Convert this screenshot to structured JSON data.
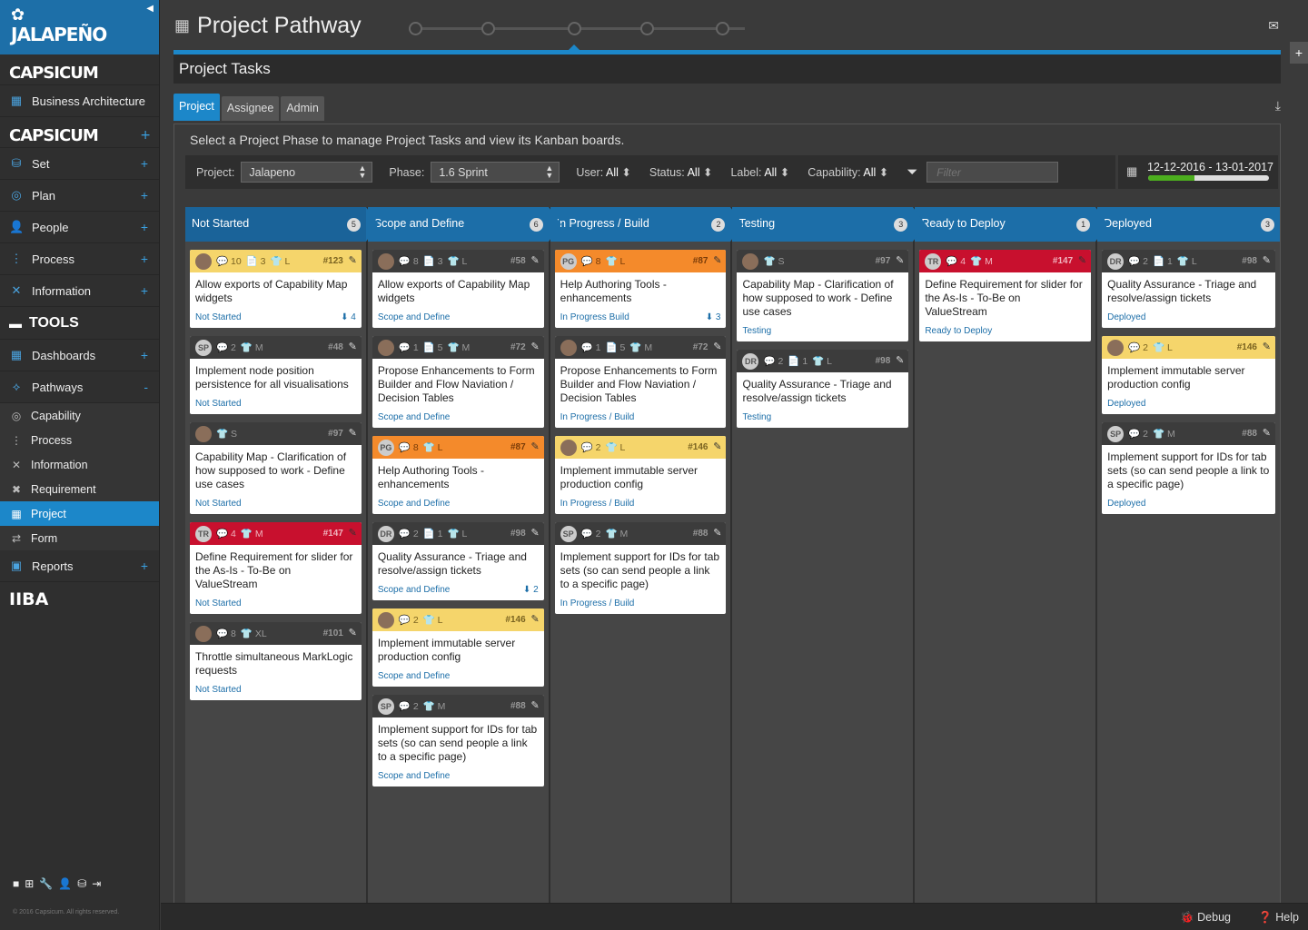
{
  "sidebar": {
    "logo": "JALAPEÑO",
    "brand1": "CAPSICUM",
    "business_architecture": "Business Architecture",
    "brand2": "CAPSICUM",
    "items": [
      {
        "label": "Set",
        "icon": "set-icon"
      },
      {
        "label": "Plan",
        "icon": "target-icon"
      },
      {
        "label": "People",
        "icon": "person-icon"
      },
      {
        "label": "Process",
        "icon": "process-icon"
      },
      {
        "label": "Information",
        "icon": "tools-icon"
      }
    ],
    "tools": "TOOLS",
    "dashboards": "Dashboards",
    "pathways": "Pathways",
    "pathways_toggle": "-",
    "sub_items": [
      {
        "label": "Capability"
      },
      {
        "label": "Process"
      },
      {
        "label": "Information"
      },
      {
        "label": "Requirement"
      },
      {
        "label": "Project"
      },
      {
        "label": "Form"
      }
    ],
    "reports": "Reports",
    "iiba": "IIBA",
    "copyright": "© 2016 Capsicum. All rights reserved."
  },
  "header": {
    "title": "Project Pathway",
    "subtitle": "Project Tasks"
  },
  "tabs": [
    "Project",
    "Assignee",
    "Admin"
  ],
  "instructions": "Select a Project Phase to manage Project Tasks and view its Kanban boards.",
  "filters": {
    "project_label": "Project:",
    "project_value": "Jalapeno",
    "phase_label": "Phase:",
    "phase_value": "1.6 Sprint",
    "user": {
      "label": "User:",
      "value": "All"
    },
    "status": {
      "label": "Status:",
      "value": "All"
    },
    "label": {
      "label": "Label:",
      "value": "All"
    },
    "capability": {
      "label": "Capability:",
      "value": "All"
    },
    "filter_placeholder": "Filter"
  },
  "date_range": {
    "text": "12-12-2016 - 13-01-2017",
    "progress": 0.38
  },
  "columns": [
    {
      "title": "Not Started",
      "count": "5",
      "cards": [
        {
          "color": "yellow",
          "avatar": "",
          "photo": true,
          "meta": [
            "💬 10",
            "📄 3",
            "👕 L"
          ],
          "num": "#123",
          "title": "Allow exports of Capability Map widgets",
          "status": "Not Started",
          "arrow": "4"
        },
        {
          "color": "dark",
          "avatar": "SP",
          "photo": false,
          "meta": [
            "💬 2",
            "👕 M"
          ],
          "num": "#48",
          "title": "Implement node position persistence for all visualisations",
          "status": "Not Started",
          "arrow": ""
        },
        {
          "color": "dark",
          "avatar": "",
          "photo": true,
          "meta": [
            "👕 S"
          ],
          "num": "#97",
          "title": "Capability Map - Clarification of how supposed to work - Define use cases",
          "status": "Not Started",
          "arrow": ""
        },
        {
          "color": "red",
          "avatar": "TR",
          "photo": false,
          "meta": [
            "💬 4",
            "👕 M"
          ],
          "num": "#147",
          "title": "Define Requirement for slider for the As-Is - To-Be on ValueStream",
          "status": "Not Started",
          "arrow": ""
        },
        {
          "color": "dark",
          "avatar": "",
          "photo": true,
          "meta": [
            "💬 8",
            "👕 XL"
          ],
          "num": "#101",
          "title": "Throttle simultaneous MarkLogic requests",
          "status": "Not Started",
          "arrow": ""
        }
      ]
    },
    {
      "title": "Scope and Define",
      "count": "6",
      "cards": [
        {
          "color": "dark",
          "avatar": "",
          "photo": true,
          "meta": [
            "💬 8",
            "📄 3",
            "👕 L"
          ],
          "num": "#58",
          "title": "Allow exports of Capability Map widgets",
          "status": "Scope and Define",
          "arrow": ""
        },
        {
          "color": "dark",
          "avatar": "",
          "photo": true,
          "meta": [
            "💬 1",
            "📄 5",
            "👕 M"
          ],
          "num": "#72",
          "title": "Propose Enhancements to Form Builder and Flow Naviation / Decision Tables",
          "status": "Scope and Define",
          "arrow": ""
        },
        {
          "color": "orange",
          "avatar": "PG",
          "photo": false,
          "meta": [
            "💬 8",
            "👕 L"
          ],
          "num": "#87",
          "title": "Help Authoring Tools - enhancements",
          "status": "Scope and Define",
          "arrow": ""
        },
        {
          "color": "dark",
          "avatar": "DR",
          "photo": false,
          "meta": [
            "💬 2",
            "📄 1",
            "👕 L"
          ],
          "num": "#98",
          "title": "Quality Assurance - Triage and resolve/assign tickets",
          "status": "Scope and Define",
          "arrow": "2"
        },
        {
          "color": "yellow",
          "avatar": "",
          "photo": true,
          "meta": [
            "💬 2",
            "👕 L"
          ],
          "num": "#146",
          "title": "Implement immutable server production config",
          "status": "Scope and Define",
          "arrow": ""
        },
        {
          "color": "dark",
          "avatar": "SP",
          "photo": false,
          "meta": [
            "💬 2",
            "👕 M"
          ],
          "num": "#88",
          "title": "Implement support for IDs for tab sets (so can send people a link to a specific page)",
          "status": "Scope and Define",
          "arrow": ""
        }
      ]
    },
    {
      "title": "In Progress / Build",
      "count": "2",
      "cards": [
        {
          "color": "orange",
          "avatar": "PG",
          "photo": false,
          "meta": [
            "💬 8",
            "👕 L"
          ],
          "num": "#87",
          "title": "Help Authoring Tools - enhancements",
          "status": "In Progress Build",
          "arrow": "3"
        },
        {
          "color": "dark",
          "avatar": "",
          "photo": true,
          "meta": [
            "💬 1",
            "📄 5",
            "👕 M"
          ],
          "num": "#72",
          "title": "Propose Enhancements to Form Builder and Flow Naviation / Decision Tables",
          "status": "In Progress / Build",
          "arrow": ""
        },
        {
          "color": "yellow",
          "avatar": "",
          "photo": true,
          "meta": [
            "💬 2",
            "👕 L"
          ],
          "num": "#146",
          "title": "Implement immutable server production config",
          "status": "In Progress / Build",
          "arrow": ""
        },
        {
          "color": "dark",
          "avatar": "SP",
          "photo": false,
          "meta": [
            "💬 2",
            "👕 M"
          ],
          "num": "#88",
          "title": "Implement support for IDs for tab sets (so can send people a link to a specific page)",
          "status": "In Progress / Build",
          "arrow": ""
        }
      ]
    },
    {
      "title": "Testing",
      "count": "3",
      "cards": [
        {
          "color": "dark",
          "avatar": "",
          "photo": true,
          "meta": [
            "👕 S"
          ],
          "num": "#97",
          "title": "Capability Map - Clarification of how supposed to work - Define use cases",
          "status": "Testing",
          "arrow": ""
        },
        {
          "color": "dark",
          "avatar": "DR",
          "photo": false,
          "meta": [
            "💬 2",
            "📄 1",
            "👕 L"
          ],
          "num": "#98",
          "title": "Quality Assurance - Triage and resolve/assign tickets",
          "status": "Testing",
          "arrow": ""
        }
      ]
    },
    {
      "title": "Ready to Deploy",
      "count": "1",
      "cards": [
        {
          "color": "red",
          "avatar": "TR",
          "photo": false,
          "meta": [
            "💬 4",
            "👕 M"
          ],
          "num": "#147",
          "title": "Define Requirement for slider for the As-Is - To-Be on ValueStream",
          "status": "Ready to Deploy",
          "arrow": ""
        }
      ]
    },
    {
      "title": "Deployed",
      "count": "3",
      "cards": [
        {
          "color": "dark",
          "avatar": "DR",
          "photo": false,
          "meta": [
            "💬 2",
            "📄 1",
            "👕 L"
          ],
          "num": "#98",
          "title": "Quality Assurance - Triage and resolve/assign tickets",
          "status": "Deployed",
          "arrow": ""
        },
        {
          "color": "yellow",
          "avatar": "",
          "photo": true,
          "meta": [
            "💬 2",
            "👕 L"
          ],
          "num": "#146",
          "title": "Implement immutable server production config",
          "status": "Deployed",
          "arrow": ""
        },
        {
          "color": "dark",
          "avatar": "SP",
          "photo": false,
          "meta": [
            "💬 2",
            "👕 M"
          ],
          "num": "#88",
          "title": "Implement support for IDs for tab sets (so can send people a link to a specific page)",
          "status": "Deployed",
          "arrow": ""
        }
      ]
    }
  ],
  "footer": {
    "debug": "Debug",
    "help": "Help"
  }
}
